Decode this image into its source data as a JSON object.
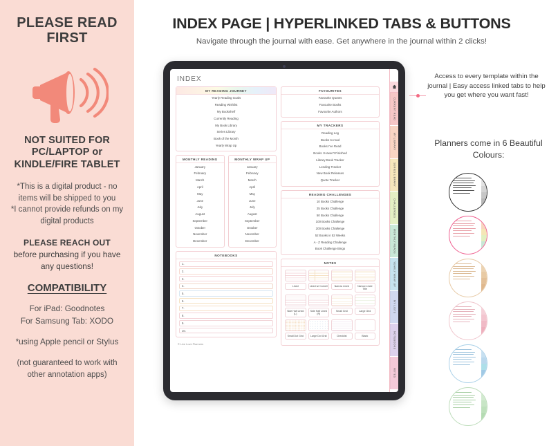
{
  "left_panel": {
    "title": "PLEASE READ FIRST",
    "icon": "megaphone-icon",
    "heading2": "NOT SUITED FOR PC/LAPTOP or KINDLE/FIRE TABLET",
    "note": "*This is a digital product - no items will be shipped to you\n*I cannot provide refunds on my digital products",
    "reach_out_bold": "PLEASE REACH OUT",
    "reach_out_rest": "before purchasing if you have any questions!",
    "compatibility_title": "COMPATIBILITY",
    "compat_lines": "For iPad: Goodnotes\nFor Samsung Tab: XODO",
    "stylus_note": "*using Apple pencil or Stylus",
    "disclaimer": "(not guaranteed to work with other annotation apps)",
    "bg_color": "#fadcd4"
  },
  "header": {
    "title": "INDEX PAGE | HYPERLINKED TABS & BUTTONS",
    "subtitle": "Navigate through the journal with ease. Get anywhere in the journal within 2 clicks!"
  },
  "tablet": {
    "index_label": "INDEX",
    "credit": "© Live Love Planners",
    "left_column": {
      "reading_journey": {
        "header": "MY READING JOURNEY",
        "items": [
          "Yearly Reading Goals",
          "Reading Wishlist",
          "My Bookshelf",
          "Currently Reading",
          "My Book Library",
          "Series Library",
          "Book of the Month",
          "Yearly Wrap Up"
        ]
      },
      "monthly_reading": {
        "header": "MONTHLY READING",
        "items": [
          "January",
          "February",
          "March",
          "April",
          "May",
          "June",
          "July",
          "August",
          "September",
          "October",
          "November",
          "December"
        ]
      },
      "monthly_wrap_up": {
        "header": "MONTHLY WRAP UP",
        "items": [
          "January",
          "February",
          "March",
          "April",
          "May",
          "June",
          "July",
          "August",
          "September",
          "October",
          "November",
          "December"
        ]
      },
      "notebooks": {
        "header": "NOTEBOOKS",
        "rows": [
          "1.",
          "2.",
          "3.",
          "4.",
          "5.",
          "6.",
          "7.",
          "8.",
          "9.",
          "10."
        ]
      }
    },
    "right_column": {
      "favourites": {
        "header": "FAVOURITES",
        "items": [
          "Favourite Quotes",
          "Favourite Books",
          "Favourite Authors"
        ]
      },
      "my_trackers": {
        "header": "MY TRACKERS",
        "items": [
          "Reading Log",
          "Books to read",
          "Books I've Read",
          "Books I Haven't Finished",
          "Library Book Tracker",
          "Lending Tracker",
          "New Book Releases",
          "Quote Tracker"
        ]
      },
      "reading_challenges": {
        "header": "READING CHALLENGES",
        "items": [
          "10 Books Challenge",
          "25 Books Challenge",
          "50 Books Challenge",
          "100 Books Challenge",
          "200 Books Challenge",
          "52 Books in 52 Weeks",
          "A - Z Reading Challenge",
          "Book Challenge Bingo"
        ]
      },
      "notes": {
        "header": "NOTES",
        "items": [
          {
            "label": "Lined",
            "style": "t-lines"
          },
          {
            "label": "Lined w/ Cornell",
            "style": "t-lines-y t-cornell"
          },
          {
            "label": "Narrow Lined",
            "style": "t-lines-n"
          },
          {
            "label": "Narrow Lined Title",
            "style": "t-lines-n"
          },
          {
            "label": "Side Half Lined (L)",
            "style": "t-half"
          },
          {
            "label": "Side Half Lined (R)",
            "style": "t-half"
          },
          {
            "label": "Small Grid",
            "style": "t-grid-s"
          },
          {
            "label": "Large Grid",
            "style": "t-grid-l"
          },
          {
            "label": "Small Dot Grid",
            "style": "t-dot-s"
          },
          {
            "label": "Large Dot Grid",
            "style": "t-dot-l"
          },
          {
            "label": "Checklist",
            "style": "t-check"
          },
          {
            "label": "Blank",
            "style": "t-blank"
          }
        ]
      }
    },
    "side_tabs": {
      "home_icon": "home-icon",
      "items": [
        {
          "label": "CURRENT READ",
          "color": "#f7c7c6"
        },
        {
          "label": "MY LIBRARY",
          "color": "#f9d5c3"
        },
        {
          "label": "SERIES LIBRARY",
          "color": "#f6e7bc"
        },
        {
          "label": "CHALLENGES",
          "color": "#e4efc4"
        },
        {
          "label": "MONTHLY READS",
          "color": "#c9e8d8"
        },
        {
          "label": "YEARLY WRAP UP",
          "color": "#c6e3ef"
        },
        {
          "label": "MY LISTS",
          "color": "#cfd8ef"
        },
        {
          "label": "NOTEBOOKS",
          "color": "#ddd1ec"
        },
        {
          "label": "NOTES",
          "color": "#f4c9d8"
        }
      ]
    }
  },
  "annotation": {
    "text": "Access to every template within the journal | Easy access linked tabs to help you get where you want fast!",
    "dot_color": "#f36a83"
  },
  "colours_section": {
    "title": "Planners come in 6 Beautiful Colours:",
    "swatches": [
      {
        "name": "black-white",
        "ring": "#2b2b2b",
        "lines": "#555555",
        "tabs": [
          "#f0f0f0",
          "#e2e2e2",
          "#d4d4d4",
          "#c6c6c6",
          "#b8b8b8",
          "#aaaaaa"
        ]
      },
      {
        "name": "rainbow-pink",
        "ring": "#ef5d8e",
        "lines": "#e8a0a8",
        "tabs": [
          "#f6c3c2",
          "#f8d6bf",
          "#f5e6b6",
          "#e2efc0",
          "#c8e7d6",
          "#c4e2ee"
        ]
      },
      {
        "name": "beige-tan",
        "ring": "#e7c9a4",
        "lines": "#dcbb96",
        "tabs": [
          "#efdcc0",
          "#ecd3b2",
          "#e8caa4",
          "#e3c098",
          "#dfb78c",
          "#dcae80"
        ]
      },
      {
        "name": "rose-pink",
        "ring": "#f0c6cd",
        "lines": "#e6b3bc",
        "tabs": [
          "#f7dbe1",
          "#f5d0d8",
          "#f3c5cf",
          "#f0bac6",
          "#eeafbd",
          "#eca4b4"
        ]
      },
      {
        "name": "blue",
        "ring": "#a9d0e8",
        "lines": "#9ec4de",
        "tabs": [
          "#d4e8f5",
          "#c7e0f1",
          "#bad8ed",
          "#addfe9",
          "#a0c9e5",
          "#93c1e1"
        ]
      },
      {
        "name": "green",
        "ring": "#bcdcb9",
        "lines": "#a8cfa4",
        "tabs": [
          "#dcefd9",
          "#d2ead0",
          "#c8e5c6",
          "#bee0bc",
          "#b4dbb2",
          "#aad6a8"
        ]
      }
    ]
  }
}
